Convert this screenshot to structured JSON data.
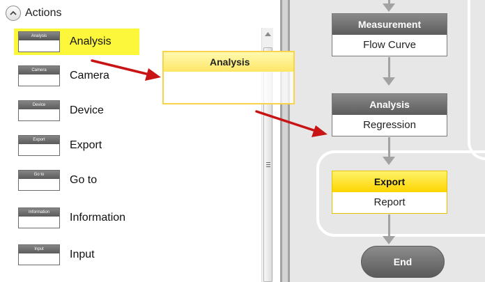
{
  "actions_panel": {
    "title": "Actions",
    "items": [
      {
        "label": "Analysis",
        "thumb": "Analysis",
        "selected": true
      },
      {
        "label": "Camera",
        "thumb": "Camera",
        "selected": false
      },
      {
        "label": "Device",
        "thumb": "Device",
        "selected": false
      },
      {
        "label": "Export",
        "thumb": "Export",
        "selected": false
      },
      {
        "label": "Go to",
        "thumb": "Go to",
        "selected": false
      },
      {
        "label": "Information",
        "thumb": "Information",
        "selected": false
      },
      {
        "label": "Input",
        "thumb": "Input",
        "selected": false
      }
    ]
  },
  "drag_ghost": {
    "title": "Analysis"
  },
  "workflow": {
    "blocks": [
      {
        "head": "Measurement",
        "body": "Flow Curve",
        "highlight": false
      },
      {
        "head": "Analysis",
        "body": "Regression",
        "highlight": false
      },
      {
        "head": "Export",
        "body": "Report",
        "highlight": true
      }
    ],
    "end_label": "End"
  },
  "icons": {
    "collapse": "chevron-up-icon",
    "scroll_up": "scroll-up-arrow-icon",
    "scroll_grip": "grip-icon"
  },
  "colors": {
    "selection": "#fcf73a",
    "annotation_arrow": "#c81414",
    "highlight_block": "#fdd400",
    "block_header": "#6e6e6e",
    "canvas_bg": "#e7e7e7"
  }
}
